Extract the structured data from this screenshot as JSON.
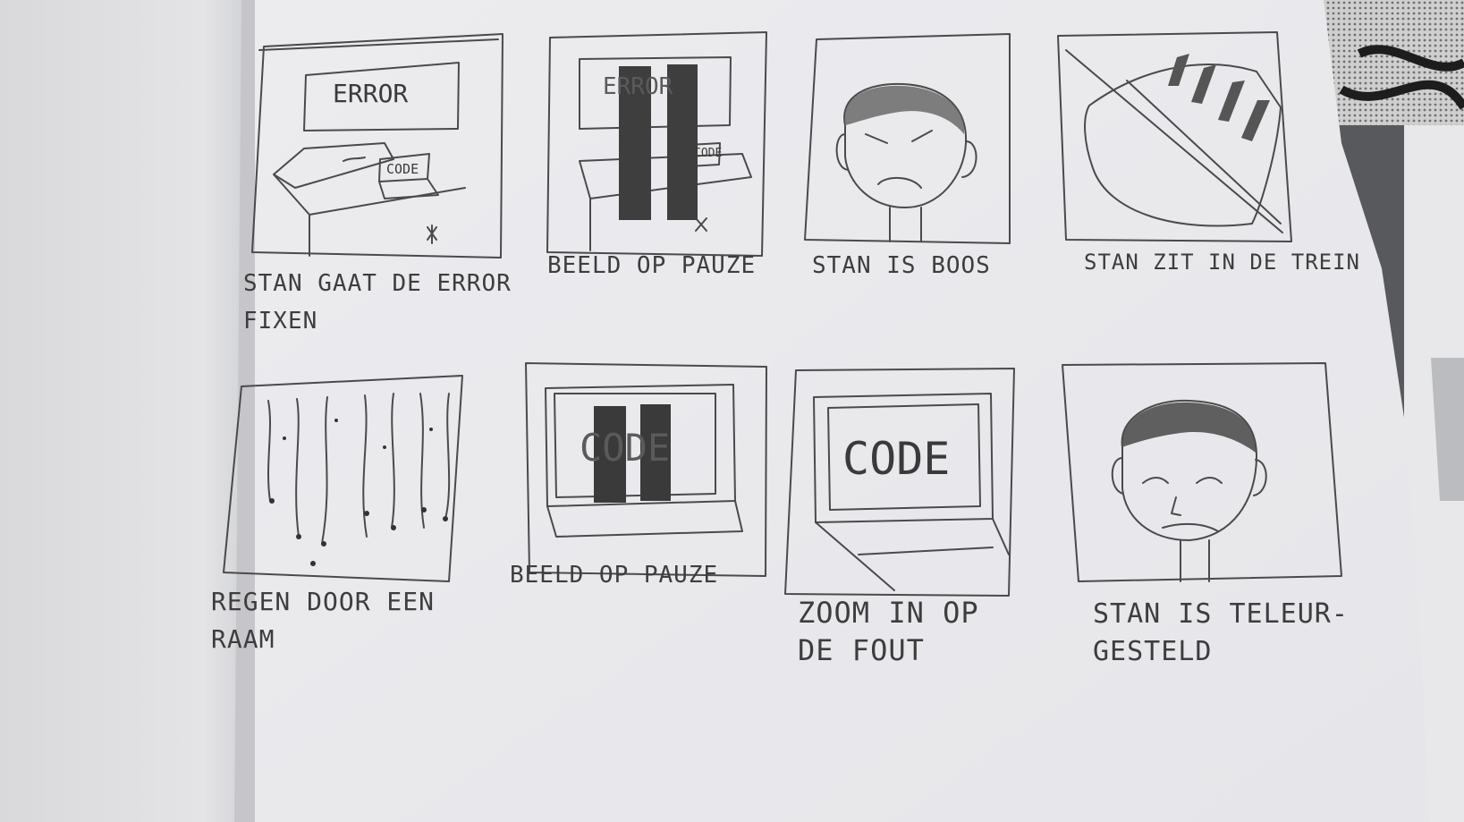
{
  "storyboard": {
    "panels": [
      {
        "caption": "STAN GAAT DE ERROR\nFIXEN",
        "screen_text": "ERROR",
        "laptop_text": "CODE"
      },
      {
        "caption": "BEELD OP PAUZE",
        "screen_text": "ERROR",
        "laptop_text": "CODE"
      },
      {
        "caption": "STAN IS BOOS"
      },
      {
        "caption": "STAN ZIT IN DE TREIN"
      },
      {
        "caption": "REGEN DOOR EEN\nRAAM"
      },
      {
        "caption": "BEELD OP PAUZE",
        "screen_text": "CODE"
      },
      {
        "caption": "ZOOM IN OP\nDE FOUT",
        "screen_text": "CODE"
      },
      {
        "caption": "STAN IS TELEUR-\nGESTELD"
      }
    ]
  },
  "colors": {
    "paper": "#efeff2",
    "pencil": "#4a4a4a",
    "desk": "#4a4c50"
  }
}
